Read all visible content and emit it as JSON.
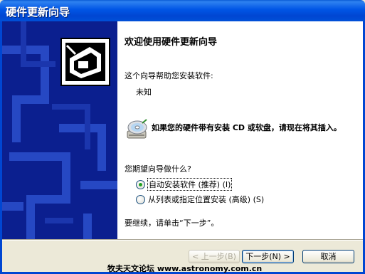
{
  "window": {
    "title": "硬件更新向导"
  },
  "wizard": {
    "heading": "欢迎使用硬件更新向导",
    "intro": "这个向导帮助您安装软件:",
    "device_name": "未知",
    "cd_instruction": "如果您的硬件带有安装 CD 或软盘，请现在将其插入。",
    "question": "您期望向导做什么?",
    "options": [
      {
        "label": "自动安装软件 (推荐) (I)",
        "checked": true
      },
      {
        "label": "从列表或指定位置安装 (高级) (S)",
        "checked": false
      }
    ],
    "continue_text": "要继续，请单击“下一步”。"
  },
  "buttons": {
    "back": "< 上一步(B)",
    "next": "下一步(N) >",
    "cancel": "取消"
  },
  "watermark": "牧夫天文论坛 www.astronomy.com.cn",
  "icons": {
    "hardware": "hardware-icon",
    "cd": "cd-icon"
  },
  "colors": {
    "titlebar": "#0055e5",
    "side_panel": "#0b1f8f",
    "radio_checked": "#21a121"
  }
}
